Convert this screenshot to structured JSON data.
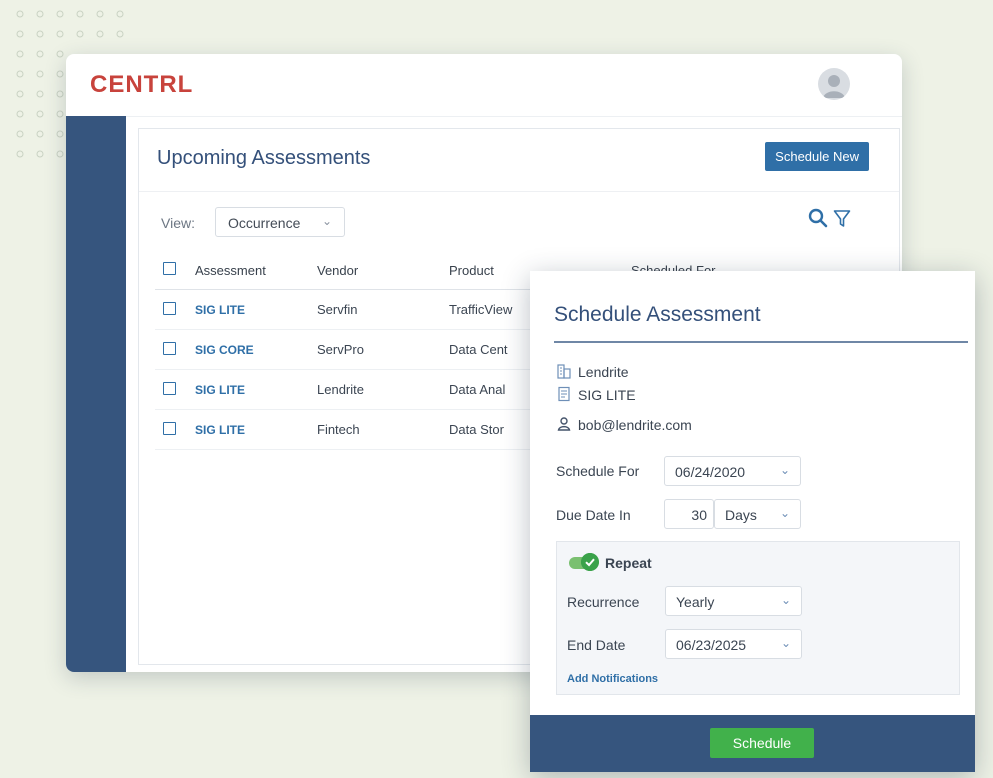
{
  "app": {
    "logo": "CENTRL"
  },
  "page": {
    "title": "Upcoming Assessments",
    "schedule_new_label": "Schedule New",
    "view_label": "View:",
    "view_value": "Occurrence"
  },
  "table": {
    "headers": [
      "Assessment",
      "Vendor",
      "Product",
      "Scheduled For"
    ],
    "rows": [
      {
        "assessment": "SIG LITE",
        "vendor": "Servfin",
        "product": "TrafficView"
      },
      {
        "assessment": "SIG CORE",
        "vendor": "ServPro",
        "product": "Data Cent"
      },
      {
        "assessment": "SIG LITE",
        "vendor": "Lendrite",
        "product": "Data Anal"
      },
      {
        "assessment": "SIG LITE",
        "vendor": "Fintech",
        "product": "Data Stor"
      }
    ]
  },
  "dialog": {
    "title": "Schedule Assessment",
    "vendor": "Lendrite",
    "assessment": "SIG LITE",
    "email": "bob@lendrite.com",
    "schedule_for_label": "Schedule For",
    "schedule_for_value": "06/24/2020",
    "due_date_label": "Due Date In",
    "due_number": "30",
    "due_unit": "Days",
    "repeat_label": "Repeat",
    "recurrence_label": "Recurrence",
    "recurrence_value": "Yearly",
    "end_date_label": "End Date",
    "end_date_value": "06/23/2025",
    "add_notifications_label": "Add Notifications",
    "schedule_button": "Schedule"
  },
  "colors": {
    "brand_red": "#c8433c",
    "navy": "#36557e",
    "link_blue": "#2f6fa7",
    "accent_green": "#41b14b"
  }
}
